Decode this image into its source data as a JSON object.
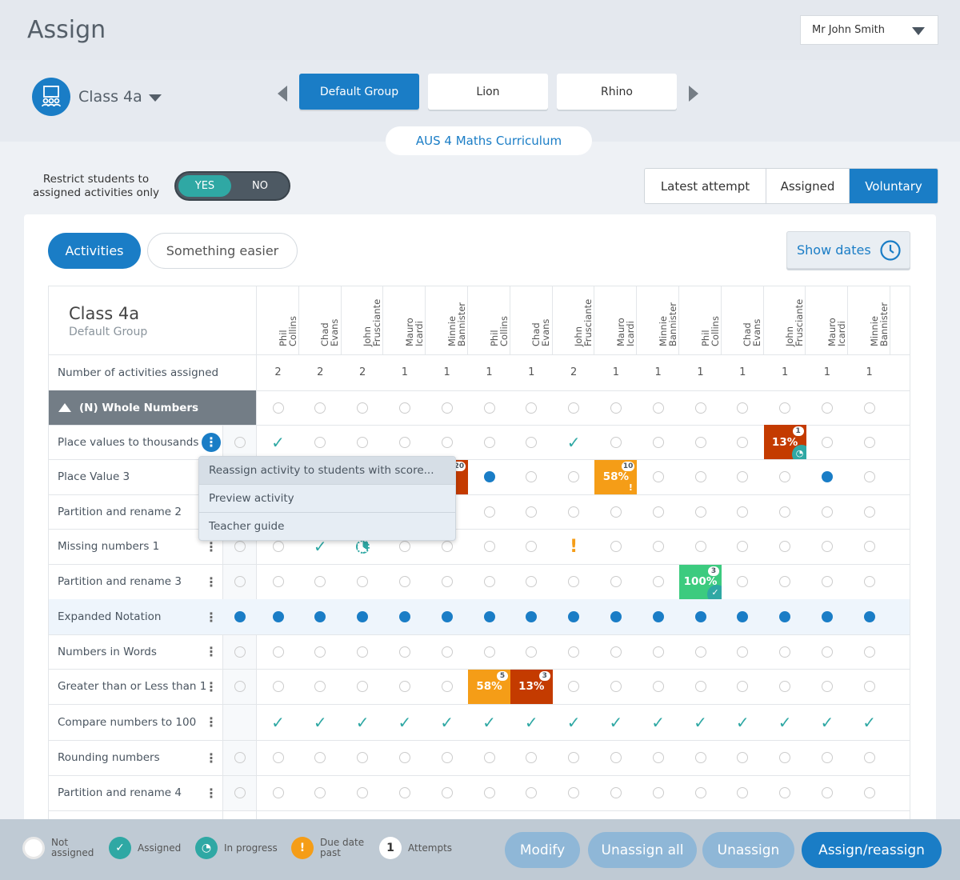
{
  "header": {
    "title": "Assign",
    "user": "Mr John Smith"
  },
  "class": {
    "name": "Class 4a",
    "icon": "classroom-icon"
  },
  "groups": [
    {
      "label": "Default Group",
      "active": true
    },
    {
      "label": "Lion",
      "active": false
    },
    {
      "label": "Rhino",
      "active": false
    }
  ],
  "curriculum": "AUS 4 Maths Curriculum",
  "restrict": {
    "label": "Restrict students to assigned activities only",
    "yes": "YES",
    "no": "NO",
    "value": "YES"
  },
  "view_modes": [
    {
      "label": "Latest attempt",
      "active": false
    },
    {
      "label": "Assigned",
      "active": false
    },
    {
      "label": "Voluntary",
      "active": true
    }
  ],
  "tabs": [
    {
      "label": "Activities",
      "active": true
    },
    {
      "label": "Something easier",
      "active": false
    }
  ],
  "show_dates": "Show dates",
  "table": {
    "title": "Class 4a",
    "subtitle": "Default Group",
    "students": [
      "Phil\nCollins",
      "Chad\nEvans",
      "John\nFrusciante",
      "Mauro\nIcardi",
      "Minnie\nBannister",
      "Phil\nCollins",
      "Chad\nEvans",
      "John\nFrusciante",
      "Mauro\nIcardi",
      "Minnie\nBannister",
      "Phil\nCollins",
      "Chad\nEvans",
      "John\nFrusciante",
      "Mauro\nIcardi",
      "Minnie\nBannister"
    ],
    "count_label": "Number of activities assigned",
    "counts": [
      "2",
      "2",
      "2",
      "1",
      "1",
      "1",
      "1",
      "2",
      "1",
      "1",
      "1",
      "1",
      "1",
      "1",
      "1"
    ],
    "section": {
      "label": "(N) Whole Numbers",
      "cells": [
        "e",
        "e",
        "e",
        "e",
        "e",
        "e",
        "e",
        "e",
        "e",
        "e",
        "e",
        "e",
        "e",
        "e",
        "e"
      ]
    },
    "rows": [
      {
        "label": "Place values to thousands",
        "menu_open": true,
        "all": "e",
        "cells": [
          "c",
          "e",
          "e",
          "e",
          "e",
          "e",
          "e",
          "c",
          "e",
          "e",
          "e",
          "e",
          {
            "score": "13%",
            "attempts": "1",
            "color": "red",
            "status": "in-progress"
          },
          "e",
          "e"
        ]
      },
      {
        "label": "Place Value 3",
        "all": "",
        "cells": [
          "",
          "",
          "",
          "",
          {
            "score": "%",
            "attempts": "20",
            "color": "red"
          },
          "f",
          "e",
          "e",
          {
            "score": "58%",
            "attempts": "10",
            "color": "orange",
            "status": "due"
          },
          "e",
          "e",
          "e",
          "e",
          "f",
          "e"
        ]
      },
      {
        "label": "Partition and rename 2",
        "all": "",
        "cells": [
          "",
          "",
          "",
          "",
          "",
          "e",
          "e",
          "e",
          "e",
          "e",
          "e",
          "e",
          "e",
          "e",
          "e"
        ]
      },
      {
        "label": "Missing numbers 1",
        "all": "e",
        "cells": [
          "e",
          "c",
          "p",
          "e",
          "e",
          "e",
          "e",
          "d",
          "e",
          "e",
          "e",
          "e",
          "e",
          "e",
          "e"
        ]
      },
      {
        "label": "Partition and rename 3",
        "all": "e",
        "cells": [
          "e",
          "e",
          "e",
          "e",
          "e",
          "e",
          "e",
          "e",
          "e",
          "e",
          {
            "score": "100%",
            "attempts": "3",
            "color": "green",
            "status": "assigned"
          },
          "e",
          "e",
          "e",
          "e"
        ]
      },
      {
        "label": "Expanded Notation",
        "highlight": true,
        "all": "f",
        "cells": [
          "f",
          "f",
          "f",
          "f",
          "f",
          "f",
          "f",
          "f",
          "f",
          "f",
          "f",
          "f",
          "f",
          "f",
          "f"
        ]
      },
      {
        "label": "Numbers in Words",
        "all": "e",
        "cells": [
          "e",
          "e",
          "e",
          "e",
          "e",
          "e",
          "e",
          "e",
          "e",
          "e",
          "e",
          "e",
          "e",
          "e",
          "e"
        ]
      },
      {
        "label": "Greater than or Less than 1",
        "all": "e",
        "cells": [
          "e",
          "e",
          "e",
          "e",
          "e",
          {
            "score": "58%",
            "attempts": "5",
            "color": "orange"
          },
          {
            "score": "13%",
            "attempts": "3",
            "color": "red"
          },
          "e",
          "e",
          "e",
          "e",
          "e",
          "e",
          "e",
          "e"
        ]
      },
      {
        "label": "Compare numbers to 100",
        "all": "",
        "cells": [
          "c",
          "c",
          "c",
          "c",
          "c",
          "c",
          "c",
          "c",
          "c",
          "c",
          "c",
          "c",
          "c",
          "c",
          "c"
        ]
      },
      {
        "label": "Rounding numbers",
        "all": "e",
        "cells": [
          "e",
          "e",
          "e",
          "e",
          "e",
          "e",
          "e",
          "e",
          "e",
          "e",
          "e",
          "e",
          "e",
          "e",
          "e"
        ]
      },
      {
        "label": "Partition and rename 4",
        "all": "e",
        "cells": [
          "e",
          "e",
          "e",
          "e",
          "e",
          "e",
          "e",
          "e",
          "e",
          "e",
          "e",
          "e",
          "e",
          "e",
          "e"
        ]
      }
    ]
  },
  "context_menu": [
    "Reassign activity to students with score...",
    "Preview activity",
    "Teacher guide"
  ],
  "legend": [
    {
      "label": "Not assigned",
      "icon": "empty-circle-icon"
    },
    {
      "label": "Assigned",
      "icon": "check-icon"
    },
    {
      "label": "In progress",
      "icon": "progress-icon"
    },
    {
      "label": "Due date past",
      "icon": "exclamation-icon"
    },
    {
      "label": "Attempts",
      "icon": "attempts-badge",
      "value": "1"
    }
  ],
  "footer_buttons": [
    {
      "label": "Modify",
      "active": false
    },
    {
      "label": "Unassign all",
      "active": false
    },
    {
      "label": "Unassign",
      "active": false
    },
    {
      "label": "Assign/reassign",
      "active": true
    }
  ],
  "colors": {
    "primary": "#1a7dc6",
    "teal": "#2fa8a4",
    "orange": "#f59d17",
    "red": "#c43b00",
    "green": "#3ccb7f"
  }
}
